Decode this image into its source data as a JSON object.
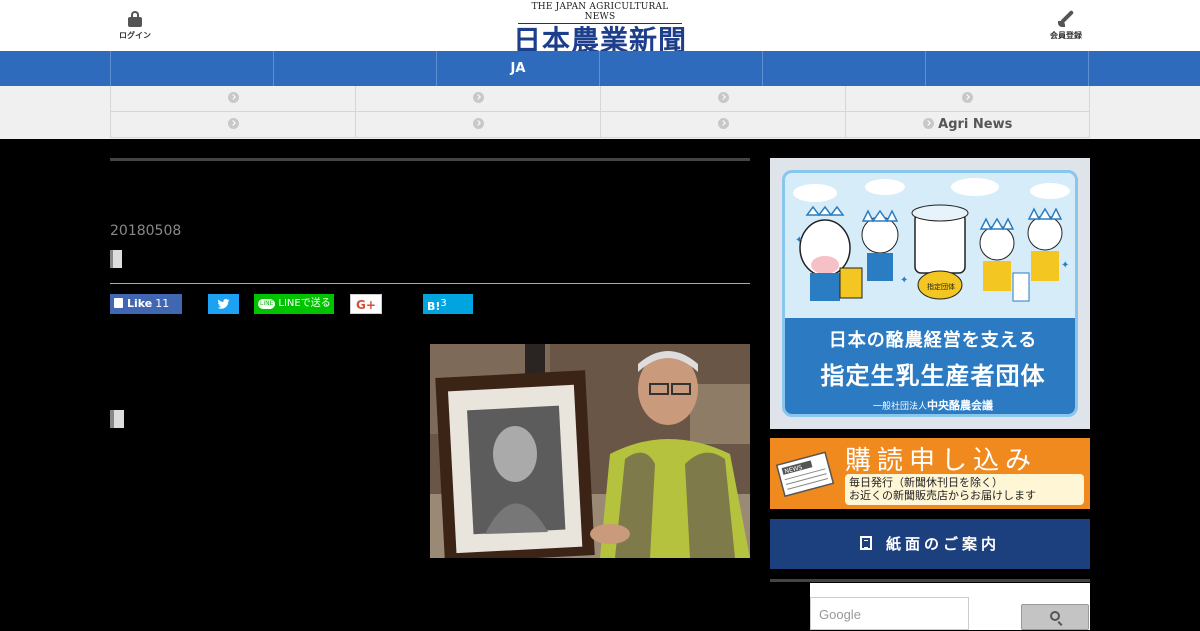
{
  "header": {
    "login_label": "ログイン",
    "register_label": "会員登録",
    "logo_en": "THE JAPAN AGRICULTURAL NEWS",
    "logo_jp": "日本農業新聞"
  },
  "nav": {
    "primary": [
      "",
      "",
      "JA",
      "",
      "",
      ""
    ],
    "secondary_row1": [
      "",
      "",
      "",
      ""
    ],
    "secondary_row2": [
      "",
      "",
      "",
      "Agri News"
    ]
  },
  "article": {
    "date": "20180508",
    "photo_alt": ""
  },
  "share": {
    "facebook_label": "Like",
    "facebook_count": "11",
    "line_label": "LINEで送る",
    "google_label": "G+",
    "hatena_label": "B!",
    "hatena_count": "3"
  },
  "sidebar": {
    "dairy_ad": {
      "line1": "日本の酪農経営を支える",
      "line2": "指定生乳生産者団体",
      "org_prefix": "一般社団法人",
      "org_name": "中央酪農会議",
      "badge": "指定団体"
    },
    "subscribe_ad": {
      "headline": "購読申し込み",
      "note_line1": "毎日発行（新聞休刊日を除く）",
      "note_line2": "お近くの新聞販売店からお届けします",
      "paper_label": "NEWS"
    },
    "paper_guide_label": "紙面のご案内",
    "search": {
      "placeholder": "Google"
    }
  },
  "colors": {
    "nav_blue": "#2e6bbd",
    "guide_navy": "#1c3f7e",
    "subscribe_orange": "#f08a1e",
    "logo_navy": "#1d3e8a"
  }
}
